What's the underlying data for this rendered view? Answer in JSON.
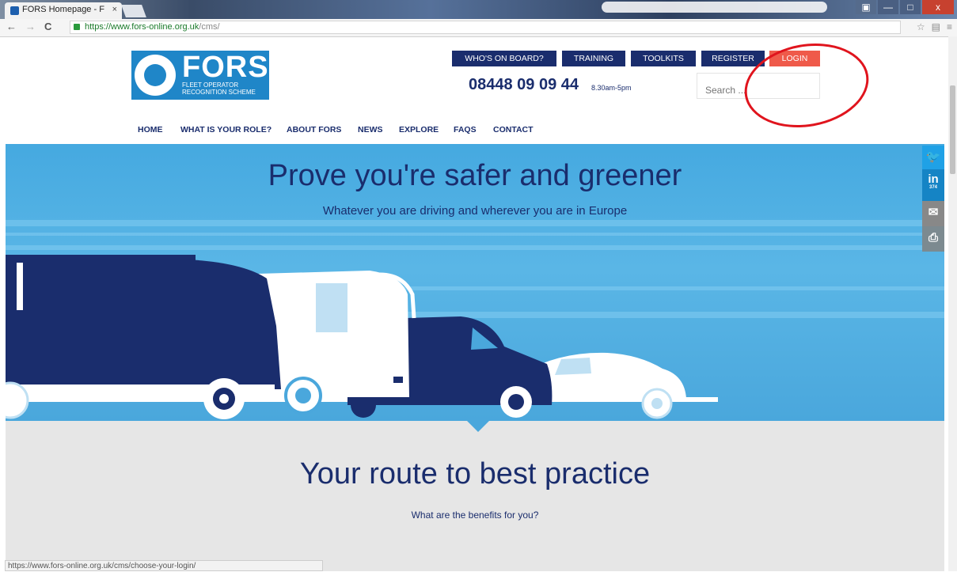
{
  "browser": {
    "tab_title": "FORS Homepage - F",
    "close_glyph": "×",
    "url_host": "https://www.fors-online.org.uk",
    "url_path": "/cms/",
    "window_buttons": {
      "user": "▣",
      "minimize": "—",
      "maximize": "□",
      "close": "x"
    },
    "nav_back": "←",
    "nav_forward": "→",
    "nav_reload": "C",
    "star_glyph": "☆",
    "menu_glyph": "≡",
    "ext_glyph": "▤"
  },
  "header": {
    "logo_big": "FORS",
    "logo_line1": "FLEET OPERATOR",
    "logo_line2": "RECOGNITION SCHEME",
    "top_nav": [
      "WHO'S ON BOARD?",
      "TRAINING",
      "TOOLKITS",
      "REGISTER",
      "LOGIN"
    ],
    "phone": "08448 09 09 44",
    "hours": "8.30am-5pm",
    "search_placeholder": "Search ..."
  },
  "main_nav": [
    "HOME",
    "WHAT IS YOUR ROLE?",
    "ABOUT FORS",
    "NEWS",
    "EXPLORE",
    "FAQS",
    "CONTACT"
  ],
  "hero": {
    "title": "Prove you're safer and greener",
    "subtitle": "Whatever you are driving and wherever you are in Europe"
  },
  "social": {
    "twitter": "🐦",
    "linkedin": "in",
    "linkedin_count": "374",
    "email": "✉",
    "print": "⎙"
  },
  "section": {
    "title": "Your route to best practice",
    "subtitle": "What are the benefits for you?"
  },
  "status_bar": "https://www.fors-online.org.uk/cms/choose-your-login/",
  "colors": {
    "navy": "#1a2d6d",
    "login": "#ef5a4a",
    "sky": "#4aa7dc",
    "annotation": "#e0141d"
  }
}
